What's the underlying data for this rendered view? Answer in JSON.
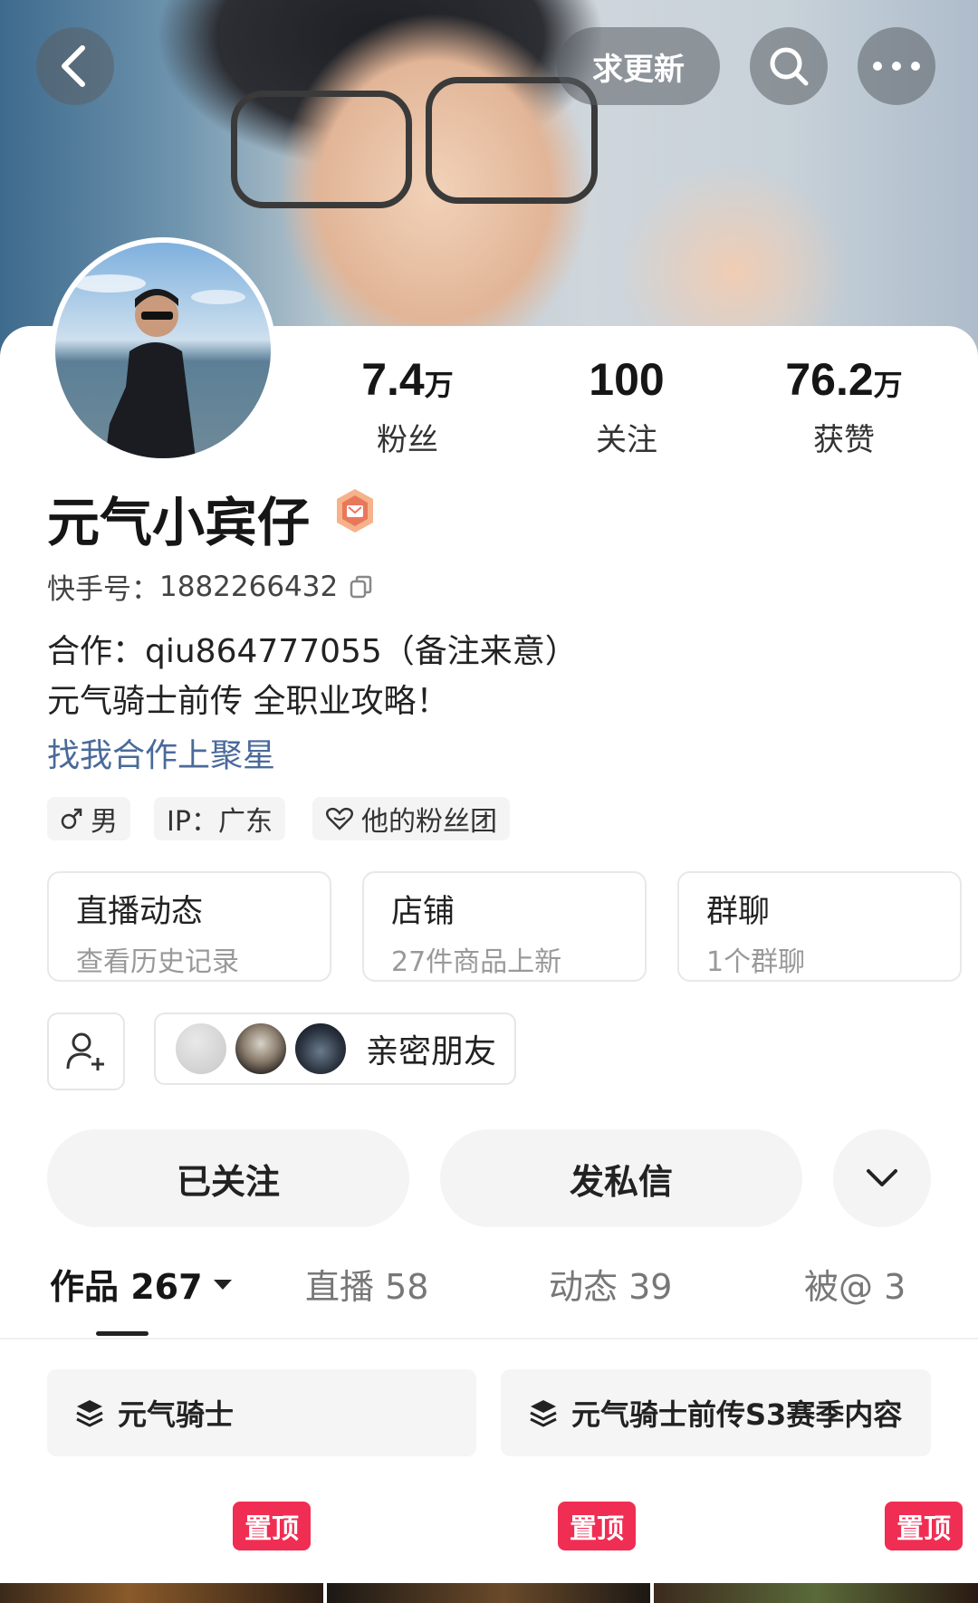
{
  "header": {
    "back_icon": "chevron-left-icon",
    "request_update_label": "求更新",
    "search_icon": "search-icon",
    "more_icon": "more-dots-icon"
  },
  "profile": {
    "name": "元气小宾仔",
    "badge_icon": "creator-badge-icon",
    "account_label": "快手号：",
    "account_id": "1882266432",
    "copy_icon": "copy-icon",
    "bio_line1": "合作：qiu864777055（备注来意）",
    "bio_line2": "元气骑士前传 全职业攻略！",
    "link_text": "找我合作上聚星"
  },
  "stats": [
    {
      "num": "7.4",
      "unit": "万",
      "label": "粉丝"
    },
    {
      "num": "100",
      "unit": "",
      "label": "关注"
    },
    {
      "num": "76.2",
      "unit": "万",
      "label": "获赞"
    }
  ],
  "tags": {
    "gender": "男",
    "ip": "IP：广东",
    "fan_club": "他的粉丝团"
  },
  "features": [
    {
      "title": "直播动态",
      "subtitle": "查看历史记录"
    },
    {
      "title": "店铺",
      "subtitle": "27件商品上新"
    },
    {
      "title": "群聊",
      "subtitle": "1个群聊"
    }
  ],
  "friends": {
    "add_icon": "add-user-icon",
    "close_friends_label": "亲密朋友"
  },
  "actions": {
    "followed": "已关注",
    "message": "发私信",
    "expand_icon": "chevron-down-icon"
  },
  "tabs": [
    {
      "label": "作品 267"
    },
    {
      "label": "直播 58"
    },
    {
      "label": "动态 39"
    },
    {
      "label": "被@ 3"
    }
  ],
  "collections": [
    {
      "label": "元气骑士"
    },
    {
      "label": "元气骑士前传S3赛季内容"
    }
  ],
  "pinned_label": "置顶",
  "colors": {
    "pin": "#f02d53",
    "link": "#4a6a9a",
    "tag_bg": "#f4f4f4"
  }
}
